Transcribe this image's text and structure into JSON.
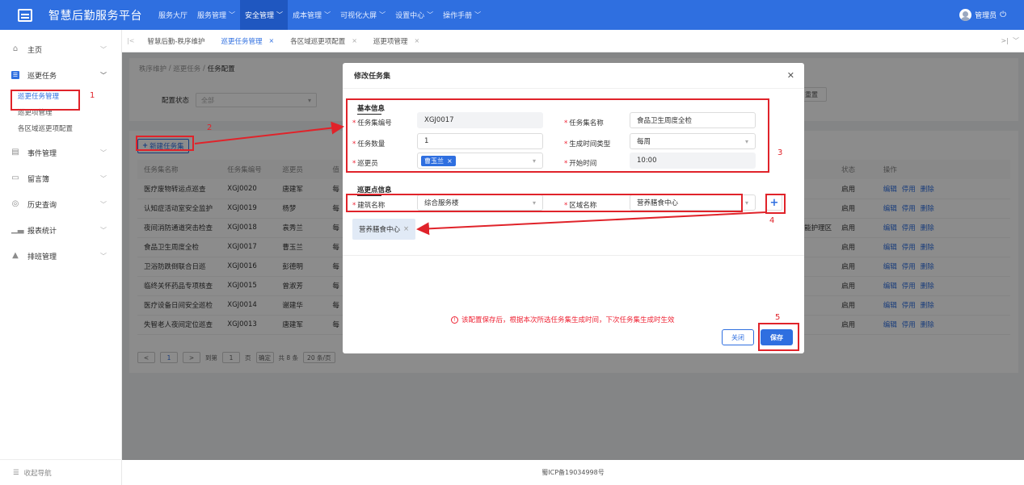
{
  "app": {
    "title": "智慧后勤服务平台"
  },
  "topnav": [
    {
      "label": "服务大厅",
      "caret": false,
      "active": false
    },
    {
      "label": "服务管理",
      "caret": true,
      "active": false
    },
    {
      "label": "安全管理",
      "caret": true,
      "active": true
    },
    {
      "label": "成本管理",
      "caret": true,
      "active": false
    },
    {
      "label": "可视化大屏",
      "caret": true,
      "active": false
    },
    {
      "label": "设置中心",
      "caret": true,
      "active": false
    },
    {
      "label": "操作手册",
      "caret": true,
      "active": false
    }
  ],
  "user": {
    "name": "管理员"
  },
  "sidebar": {
    "home": "主页",
    "patrol": "巡更任务",
    "sub_items": [
      "巡更任务管理",
      "巡更项管理",
      "各区域巡更项配置"
    ],
    "events": "事件管理",
    "guestbook": "留言簿",
    "history": "历史查询",
    "reports": "报表统计",
    "schedule": "排班管理",
    "collapse": "收起导航"
  },
  "tabs": [
    "智慧后勤-秩序维护",
    "巡更任务管理",
    "各区域巡更项配置",
    "巡更项管理"
  ],
  "breadcrumb": {
    "a": "秩序维护",
    "b": "巡更任务",
    "c": "任务配置"
  },
  "filter": {
    "label": "配置状态",
    "value": "全部",
    "reset": "重置"
  },
  "list": {
    "new_button": "新建任务集",
    "headers": [
      "任务集名称",
      "任务集编号",
      "巡更员",
      "值",
      "状态",
      "操作"
    ],
    "rows": [
      {
        "name": "医疗废物转运点巡查",
        "code": "XGJ0020",
        "staff": "唐建军",
        "v": "每",
        "extra": "",
        "status": "启用"
      },
      {
        "name": "认知症活动室安全监护",
        "code": "XGJ0019",
        "staff": "杨梦",
        "v": "每",
        "extra": "",
        "status": "启用"
      },
      {
        "name": "夜间消防通道突击检查",
        "code": "XGJ0018",
        "staff": "袁秀兰",
        "v": "每",
        "extra": "能护理区",
        "status": "启用"
      },
      {
        "name": "食品卫生周度全检",
        "code": "XGJ0017",
        "staff": "曹玉兰",
        "v": "每",
        "extra": "",
        "status": "启用"
      },
      {
        "name": "卫浴防跌倒联合日巡",
        "code": "XGJ0016",
        "staff": "彭德明",
        "v": "每",
        "extra": "",
        "status": "启用"
      },
      {
        "name": "临终关怀药品专项核查",
        "code": "XGJ0015",
        "staff": "曾淑芳",
        "v": "每",
        "extra": "",
        "status": "启用"
      },
      {
        "name": "医疗设备日间安全巡检",
        "code": "XGJ0014",
        "staff": "谢建华",
        "v": "每",
        "extra": "",
        "status": "启用"
      },
      {
        "name": "失智老人夜间定位巡查",
        "code": "XGJ0013",
        "staff": "唐建军",
        "v": "每",
        "extra": "",
        "status": "启用"
      }
    ],
    "ops": [
      "编辑",
      "停用",
      "删除"
    ],
    "pager": {
      "goto": "到第",
      "page": "1",
      "page_unit": "页",
      "confirm": "确定",
      "total": "共 8 条",
      "size": "20 条/页"
    }
  },
  "footer": "蜀ICP备19034998号",
  "modal": {
    "title": "修改任务集",
    "basic_title": "基本信息",
    "code_label": "任务集编号",
    "code_value": "XGJ0017",
    "name_label": "任务集名称",
    "name_value": "食品卫生周度全检",
    "count_label": "任务数量",
    "count_value": "1",
    "gen_label": "生成时间类型",
    "gen_value": "每周",
    "staff_label": "巡更员",
    "staff_tag": "曹玉兰",
    "start_label": "开始时间",
    "start_value": "10:00",
    "point_title": "巡更点信息",
    "building_label": "建筑名称",
    "building_value": "综合服务楼",
    "area_label": "区域名称",
    "area_value": "营养膳食中心",
    "chip": "营养膳食中心",
    "notice": "该配置保存后，根据本次所选任务集生成时间，下次任务集生成时生效",
    "close_btn": "关闭",
    "save_btn": "保存"
  },
  "annotations": [
    "1",
    "2",
    "3",
    "4",
    "5"
  ],
  "colors": {
    "brand": "#2f6fe0",
    "annotation": "#e0232a"
  }
}
